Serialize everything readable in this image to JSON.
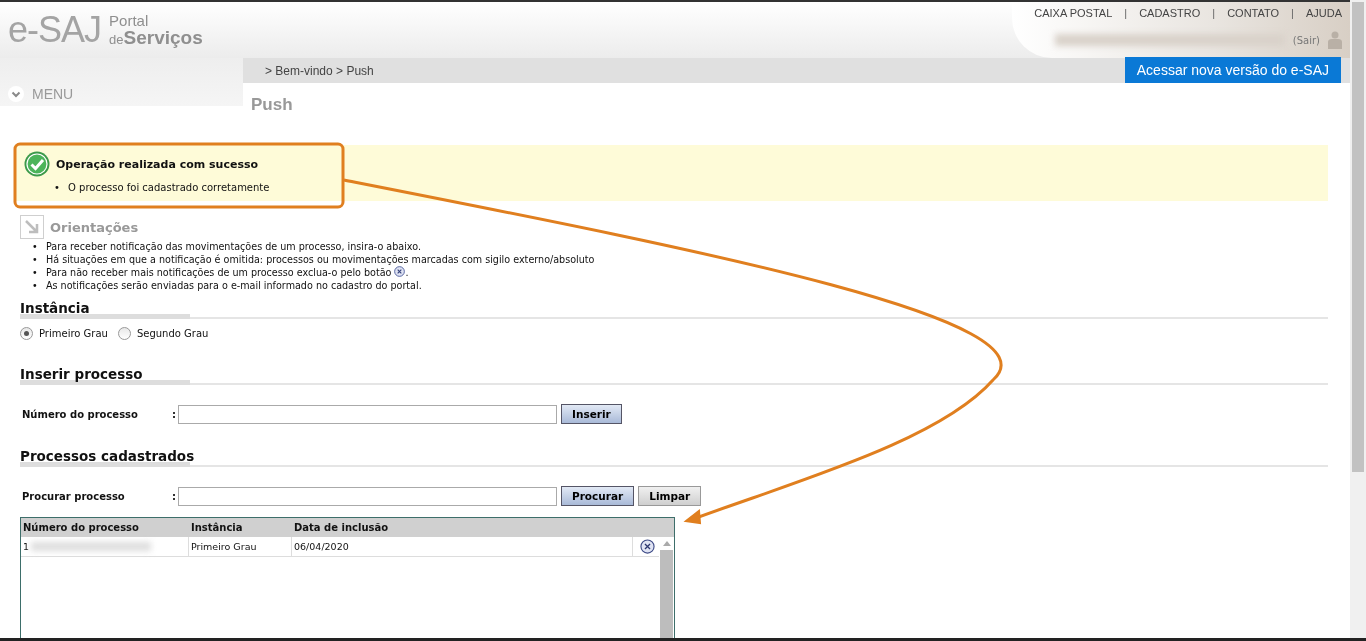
{
  "logo": {
    "mark": "e-SAJ",
    "line1": "Portal",
    "line2_small": "de",
    "line2": "Serviços"
  },
  "top_links": [
    "CAIXA POSTAL",
    "|",
    "CADASTRO",
    "|",
    "CONTATO",
    "|",
    "AJUDA"
  ],
  "user": {
    "logout": "(Sair)"
  },
  "breadcrumb": "> Bem-vindo > Push",
  "new_version_button": "Acessar nova versão do e-SAJ",
  "menu": "MENU",
  "page_title": "Push",
  "bullet": "•",
  "success": {
    "title": "Operação realizada com sucesso",
    "items": [
      "O processo foi cadastrado corretamente"
    ]
  },
  "guidance": {
    "title": "Orientações",
    "items": [
      {
        "text": "Para receber notificação das movimentações de um processo, insira-o abaixo.",
        "icon": false
      },
      {
        "text": "Há situações em que a notificação é omitida: processos ou movimentações marcadas com sigilo externo/absoluto",
        "icon": false
      },
      {
        "text": "Para não receber mais notificações de um processo exclua-o pelo botão",
        "icon": true,
        "after": "."
      },
      {
        "text": "As notificações serão enviadas para o e-mail informado no cadastro do portal.",
        "icon": false
      }
    ]
  },
  "instancia": {
    "title": "Instância",
    "options": [
      {
        "label": "Primeiro Grau",
        "selected": true
      },
      {
        "label": "Segundo Grau",
        "selected": false
      }
    ]
  },
  "inserir": {
    "title": "Inserir processo",
    "label": "Número do processo",
    "colon": ":",
    "button": "Inserir"
  },
  "cadastrados": {
    "title": "Processos cadastrados",
    "label": "Procurar processo",
    "colon": ":",
    "search_button": "Procurar",
    "clear_button": "Limpar",
    "table": {
      "columns": [
        "Número do processo",
        "Instância",
        "Data de inclusão"
      ],
      "rows": [
        {
          "numero": "1",
          "instancia": "Primeiro Grau",
          "data": "06/04/2020"
        }
      ]
    }
  }
}
